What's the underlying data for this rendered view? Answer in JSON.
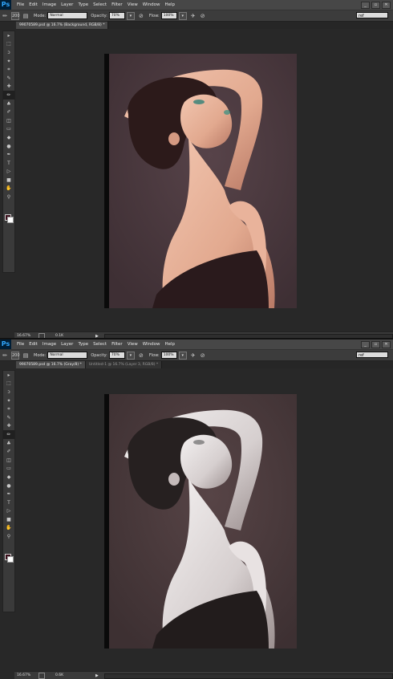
{
  "menu": {
    "logo": "Ps",
    "items": [
      "File",
      "Edit",
      "Image",
      "Layer",
      "Type",
      "Select",
      "Filter",
      "View",
      "Window",
      "Help"
    ],
    "window_buttons": [
      "_",
      "▫",
      "✕"
    ]
  },
  "options": {
    "brush_size": "200",
    "mode_label": "Mode:",
    "mode_value": "Normal",
    "opacity_label": "Opacity:",
    "opacity_value": "70%",
    "flow_label": "Flow:",
    "flow_value": "100%",
    "workspace": "ref"
  },
  "top": {
    "tabs": [
      "99070589.psd @ 16.7% (Background, RGB/8) *"
    ],
    "zoom": "16.67%",
    "doc": "0.1K"
  },
  "bottom": {
    "tabs": [
      "99070589.psd @ 16.7% (Gray/8) *",
      "Untitled-1 @ 16.7% (Layer 3, RGB/8) *"
    ],
    "zoom": "16.67%",
    "doc": "0.6K"
  },
  "tools": [
    "move-tool",
    "marquee-tool",
    "lasso-tool",
    "quick-select-tool",
    "crop-tool",
    "eyedropper-tool",
    "healing-tool",
    "brush-tool",
    "clone-stamp-tool",
    "history-brush-tool",
    "eraser-tool",
    "gradient-tool",
    "blur-tool",
    "dodge-tool",
    "pen-tool",
    "type-tool",
    "path-select-tool",
    "rectangle-tool",
    "hand-tool",
    "zoom-tool"
  ],
  "tool_glyphs": [
    "▸",
    "⬚",
    "ↄ",
    "✦",
    "⌗",
    "✎",
    "✚",
    "✏",
    "♣",
    "✐",
    "◫",
    "▭",
    "◆",
    "●",
    "✒",
    "T",
    "▷",
    "■",
    "✋",
    "⚲"
  ],
  "colors": {
    "foreground": "#3d0f1c",
    "background": "#ffffff",
    "accent": "#31a8ff",
    "photo_bg_color": "#4a383d",
    "photo_bg_gray": "#4a3b3b"
  }
}
